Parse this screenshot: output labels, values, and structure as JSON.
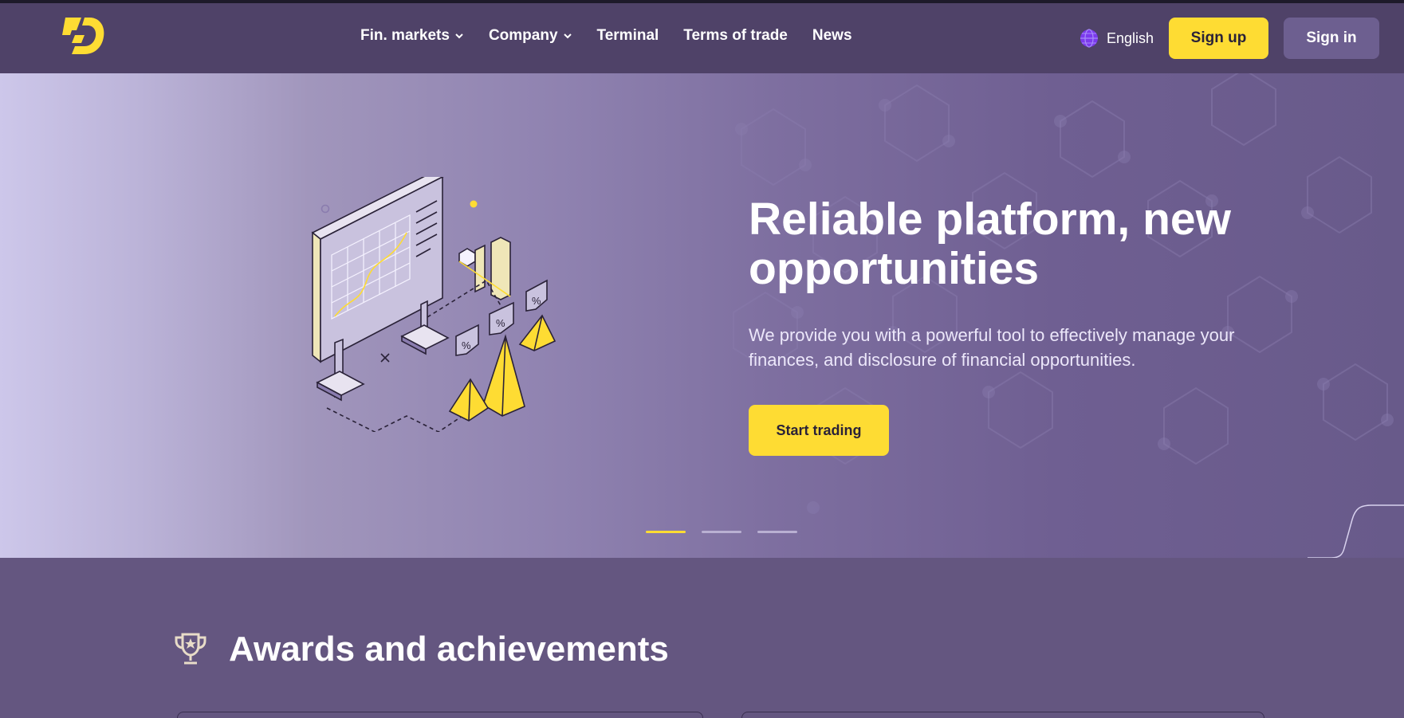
{
  "header": {
    "logo_icon": "lightning-d-logo-icon",
    "nav": [
      {
        "label": "Fin. markets",
        "has_dropdown": true
      },
      {
        "label": "Company",
        "has_dropdown": true
      },
      {
        "label": "Terminal",
        "has_dropdown": false
      },
      {
        "label": "Terms of trade",
        "has_dropdown": false
      },
      {
        "label": "News",
        "has_dropdown": false
      }
    ],
    "language": {
      "icon": "globe-icon",
      "label": "English"
    },
    "signup_label": "Sign up",
    "signin_label": "Sign in"
  },
  "hero": {
    "title": "Reliable platform, new opportunities",
    "subtitle": "We provide you with a powerful tool to effectively manage your finances, and disclosure of financial opportunities.",
    "cta_label": "Start trading",
    "illustration_icon": "trading-board-illustration",
    "slides": {
      "count": 3,
      "active": 1
    }
  },
  "awards": {
    "icon": "trophy-icon",
    "title": "Awards and achievements"
  },
  "colors": {
    "accent_yellow": "#fedc33",
    "header_bg": "#4f4268",
    "section_bg": "#645680",
    "signin_bg": "#6d5f90"
  }
}
